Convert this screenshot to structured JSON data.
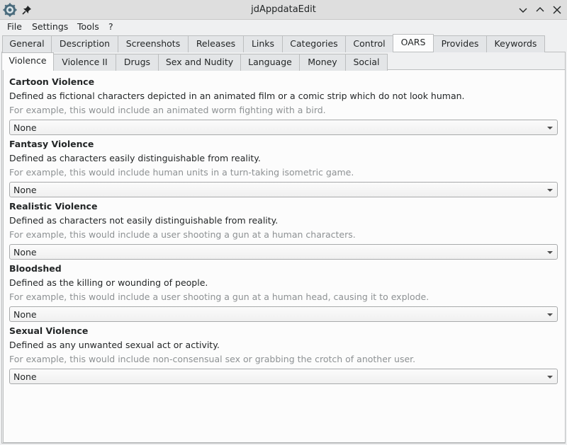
{
  "window": {
    "title": "jdAppdataEdit"
  },
  "menu": [
    "File",
    "Settings",
    "Tools",
    "?"
  ],
  "main_tabs": [
    {
      "label": "General"
    },
    {
      "label": "Description"
    },
    {
      "label": "Screenshots"
    },
    {
      "label": "Releases"
    },
    {
      "label": "Links"
    },
    {
      "label": "Categories"
    },
    {
      "label": "Control"
    },
    {
      "label": "OARS"
    },
    {
      "label": "Provides"
    },
    {
      "label": "Keywords"
    }
  ],
  "sub_tabs": [
    {
      "label": "Violence"
    },
    {
      "label": "Violence II"
    },
    {
      "label": "Drugs"
    },
    {
      "label": "Sex and Nudity"
    },
    {
      "label": "Language"
    },
    {
      "label": "Money"
    },
    {
      "label": "Social"
    }
  ],
  "sections": [
    {
      "title": "Cartoon Violence",
      "description": "Defined as fictional characters depicted in an animated film or a comic strip which do not look human.",
      "example": "For example, this would include an animated worm fighting with a bird.",
      "value": "None"
    },
    {
      "title": "Fantasy Violence",
      "description": "Defined as characters easily distinguishable from reality.",
      "example": "For example, this would include human units in a turn-taking isometric game.",
      "value": "None"
    },
    {
      "title": "Realistic Violence",
      "description": "Defined as characters not easily distinguishable from reality.",
      "example": "For example, this would include a user shooting a gun at a human characters.",
      "value": "None"
    },
    {
      "title": "Bloodshed",
      "description": "Defined as the killing or wounding of people.",
      "example": "For example, this would include a user shooting a gun at a human head, causing it to explode.",
      "value": "None"
    },
    {
      "title": "Sexual Violence",
      "description": "Defined as any unwanted sexual act or activity.",
      "example": "For example, this would include non-consensual sex or grabbing the crotch of another user.",
      "value": "None"
    }
  ]
}
